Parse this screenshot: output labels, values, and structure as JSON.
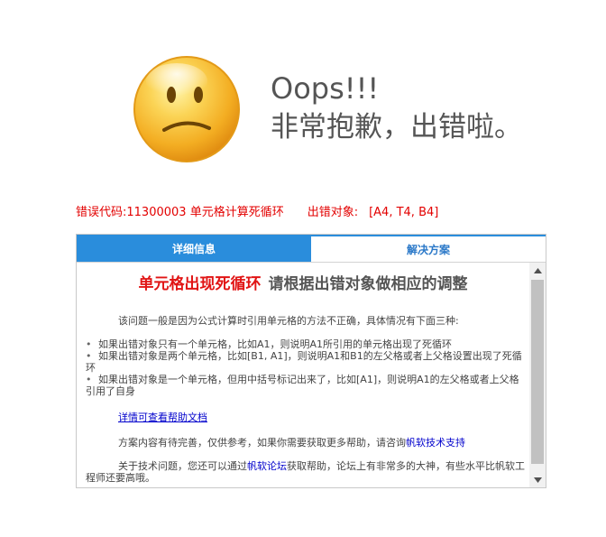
{
  "header": {
    "title": "Oops!!!",
    "subtitle": "非常抱歉，出错啦。"
  },
  "error": {
    "code_label": "错误代码:",
    "code_value": "11300003 单元格计算死循环",
    "object_label": "出错对象:",
    "object_value": "[A4, T4, B4]"
  },
  "tabs": [
    {
      "label": "详细信息"
    },
    {
      "label": "解决方案"
    }
  ],
  "solution": {
    "heading_red": "单元格出现死循环",
    "heading_grey": "请根据出错对象做相应的调整",
    "intro": "该问题一般是因为公式计算时引用单元格的方法不正确，具体情况有下面三种:",
    "cases": [
      "如果出错对象只有一个单元格，比如A1，则说明A1所引用的单元格出现了死循环",
      "如果出错对象是两个单元格，比如[B1, A1]，则说明A1和B1的左父格或者上父格设置出现了死循环",
      "如果出错对象是一个单元格，但用中括号标记出来了，比如[A1]，则说明A1的左父格或者上父格引用了自身"
    ],
    "help_link": "详情可查看帮助文档",
    "more_help_prefix": "方案内容有待完善，仅供参考，如果你需要获取更多帮助，请咨询",
    "support_link": "帆软技术支持",
    "forum_prefix": "关于技术问题，您还可以通过",
    "forum_link": "帆软论坛",
    "forum_suffix": "获取帮助，论坛上有非常多的大神，有些水平比帆软工程师还要高哦。"
  },
  "colors": {
    "accent": "#2a8ddc",
    "error_text": "#e30000",
    "heading_red": "#e11414",
    "face": "#f7c640"
  },
  "icons": {
    "face": "sad-face-icon",
    "scroll_up": "arrow-up-icon",
    "scroll_down": "arrow-down-icon"
  }
}
